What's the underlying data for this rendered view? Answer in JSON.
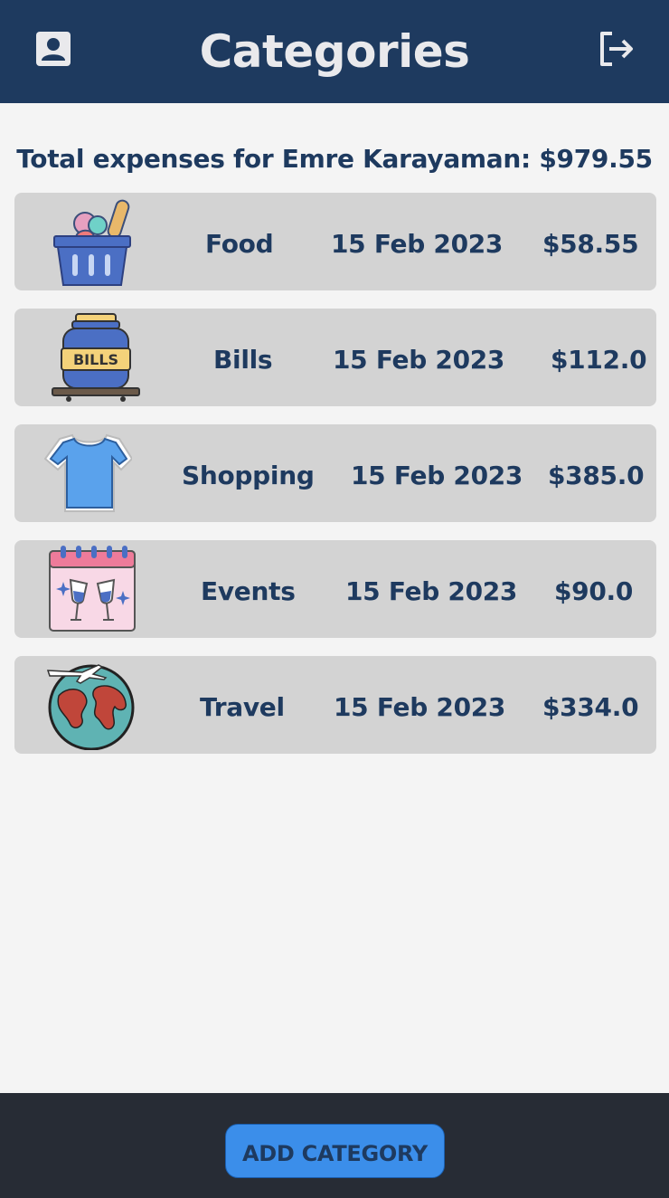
{
  "header": {
    "title": "Categories",
    "profile_icon": "profile-card-icon",
    "logout_icon": "logout-icon",
    "background": "#1e3a5f"
  },
  "summary": {
    "total_text": "Total expenses for Emre Karayaman: $979.55"
  },
  "categories": [
    {
      "name": "Food",
      "date": "15 Feb 2023",
      "amount": "$58.55",
      "icon": "food-basket-icon"
    },
    {
      "name": "Bills",
      "date": "15 Feb 2023",
      "amount": "$112.0",
      "icon": "bills-jar-icon"
    },
    {
      "name": "Shopping",
      "date": "15 Feb 2023",
      "amount": "$385.0",
      "icon": "tshirt-icon"
    },
    {
      "name": "Events",
      "date": "15 Feb 2023",
      "amount": "$90.0",
      "icon": "calendar-toast-icon"
    },
    {
      "name": "Travel",
      "date": "15 Feb 2023",
      "amount": "$334.0",
      "icon": "globe-airplane-icon"
    }
  ],
  "footer": {
    "add_label": "ADD CATEGORY",
    "accent": "#3b8eea"
  }
}
